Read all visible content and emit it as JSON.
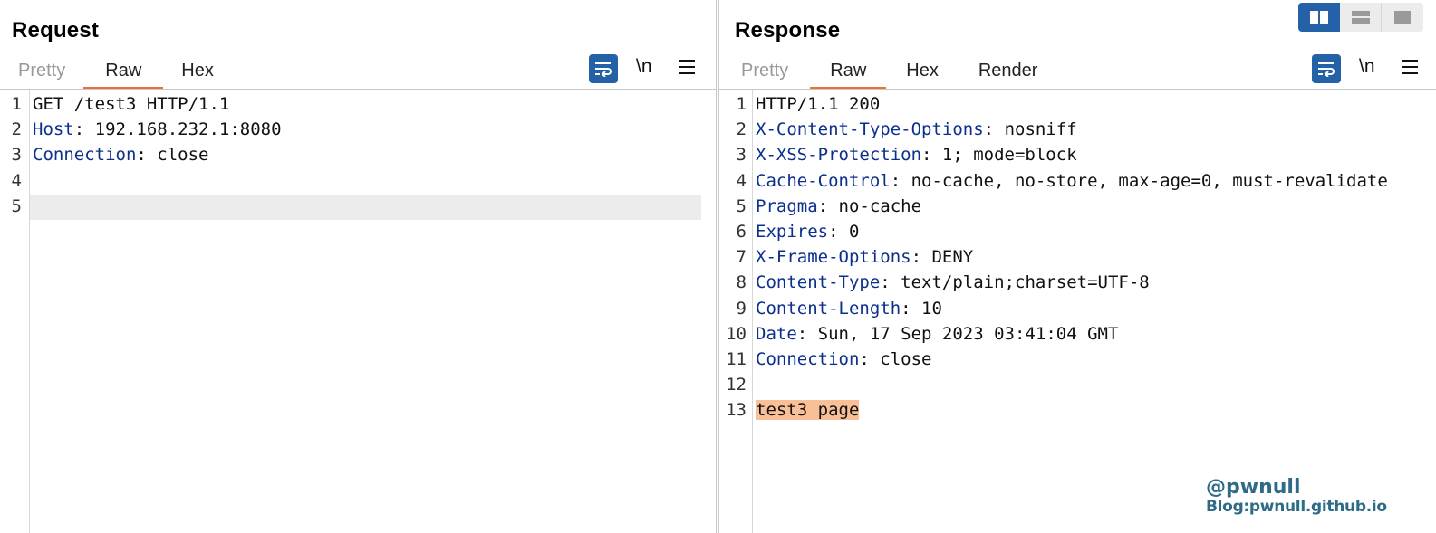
{
  "request": {
    "title": "Request",
    "tabs": [
      {
        "label": "Pretty",
        "active": false
      },
      {
        "label": "Raw",
        "active": true
      },
      {
        "label": "Hex",
        "active": false
      }
    ],
    "toolbar": {
      "wrap_icon": "wrap-lines-icon",
      "newline_label": "\\n",
      "menu_icon": "hamburger-menu-icon"
    },
    "lines": [
      {
        "num": "1",
        "key": "",
        "sep": "",
        "value": "GET /test3 HTTP/1.1"
      },
      {
        "num": "2",
        "key": "Host",
        "sep": ": ",
        "value": "192.168.232.1:8080"
      },
      {
        "num": "3",
        "key": "Connection",
        "sep": ": ",
        "value": "close"
      },
      {
        "num": "4",
        "key": "",
        "sep": "",
        "value": ""
      },
      {
        "num": "5",
        "key": "",
        "sep": "",
        "value": ""
      }
    ]
  },
  "response": {
    "title": "Response",
    "tabs": [
      {
        "label": "Pretty",
        "active": false
      },
      {
        "label": "Raw",
        "active": true
      },
      {
        "label": "Hex",
        "active": false
      },
      {
        "label": "Render",
        "active": false
      }
    ],
    "toolbar": {
      "wrap_icon": "wrap-lines-icon",
      "newline_label": "\\n",
      "menu_icon": "hamburger-menu-icon"
    },
    "lines": [
      {
        "num": "1",
        "key": "",
        "sep": "",
        "value": "HTTP/1.1 200"
      },
      {
        "num": "2",
        "key": "X-Content-Type-Options",
        "sep": ": ",
        "value": "nosniff"
      },
      {
        "num": "3",
        "key": "X-XSS-Protection",
        "sep": ": ",
        "value": "1; mode=block"
      },
      {
        "num": "4",
        "key": "Cache-Control",
        "sep": ": ",
        "value": "no-cache, no-store, max-age=0, must-revalidate"
      },
      {
        "num": "5",
        "key": "Pragma",
        "sep": ": ",
        "value": "no-cache"
      },
      {
        "num": "6",
        "key": "Expires",
        "sep": ": ",
        "value": "0"
      },
      {
        "num": "7",
        "key": "X-Frame-Options",
        "sep": ": ",
        "value": "DENY"
      },
      {
        "num": "8",
        "key": "Content-Type",
        "sep": ": ",
        "value": "text/plain;charset=UTF-8"
      },
      {
        "num": "9",
        "key": "Content-Length",
        "sep": ": ",
        "value": "10"
      },
      {
        "num": "10",
        "key": "Date",
        "sep": ": ",
        "value": "Sun, 17 Sep 2023 03:41:04 GMT"
      },
      {
        "num": "11",
        "key": "Connection",
        "sep": ": ",
        "value": "close"
      },
      {
        "num": "12",
        "key": "",
        "sep": "",
        "value": ""
      },
      {
        "num": "13",
        "key": "",
        "sep": "",
        "value": "test3 page",
        "highlight": true
      }
    ]
  },
  "view_switch": {
    "options": [
      "side-by-side-layout-icon",
      "stacked-layout-icon",
      "single-pane-layout-icon"
    ],
    "active_index": 0
  },
  "watermark": {
    "handle": "@pwnull",
    "blog": "Blog:pwnull.github.io"
  },
  "colors": {
    "accent_tab_underline": "#e8703a",
    "tool_button": "#2461a6",
    "header_key": "#0b2f8c",
    "body_highlight": "#f9c097",
    "caret_line": "#ececec",
    "watermark": "#2e6b86"
  }
}
